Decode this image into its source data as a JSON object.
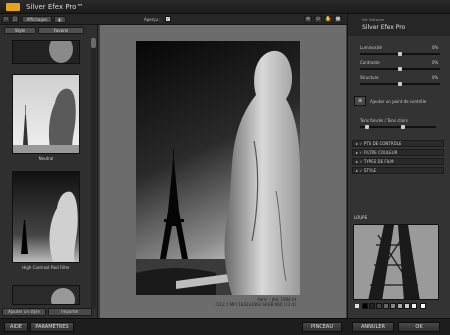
{
  "app": {
    "title": "Silver Efex Pro™"
  },
  "toolbar": {
    "affichages_label": "Affichages",
    "apercu_label": "Aperçu :",
    "apercu_check": "✓"
  },
  "left": {
    "tabs": [
      "Style",
      "Favoris"
    ],
    "thumbs": [
      {
        "label": "Neutral"
      },
      {
        "label": "High Contrast Red Filter"
      }
    ],
    "bottom_buttons": [
      "Ajouter un style",
      "Importer"
    ]
  },
  "canvas": {
    "caption_line1": "Paris – JAH_1984.tif",
    "caption_line2": "(112.7 MP) 1842x2662 SRGB 8bit (12:4)"
  },
  "right": {
    "header_top": "Nik Software",
    "header_title": "Silver Efex Pro",
    "sliders": [
      {
        "label": "Luminosité",
        "value": "0%",
        "pos": 0.5
      },
      {
        "label": "Contraste",
        "value": "0%",
        "pos": 0.5
      },
      {
        "label": "Structure",
        "value": "0%",
        "pos": 0.5
      }
    ],
    "add_point_label": "Ajouter un point de contrôle",
    "tone_label": "Tons foncés / Tons clairs",
    "sections": [
      "PTS DE CONTRÔLE",
      "FILTRE COULEUR",
      "TYPES DE FILM",
      "STYLE"
    ],
    "loupe_label": "LOUPE"
  },
  "bottom": {
    "aide": "AIDE",
    "parametres": "PARAMÈTRES",
    "pinceau": "PINCEAU",
    "annuler": "ANNULER",
    "ok": "OK"
  },
  "colors": {
    "accent": "#e8a31a",
    "panel": "#333333",
    "canvas": "#6c6c6c"
  },
  "icons": [
    "gear-icon",
    "check-icon",
    "zoom-icon",
    "view-icon"
  ]
}
